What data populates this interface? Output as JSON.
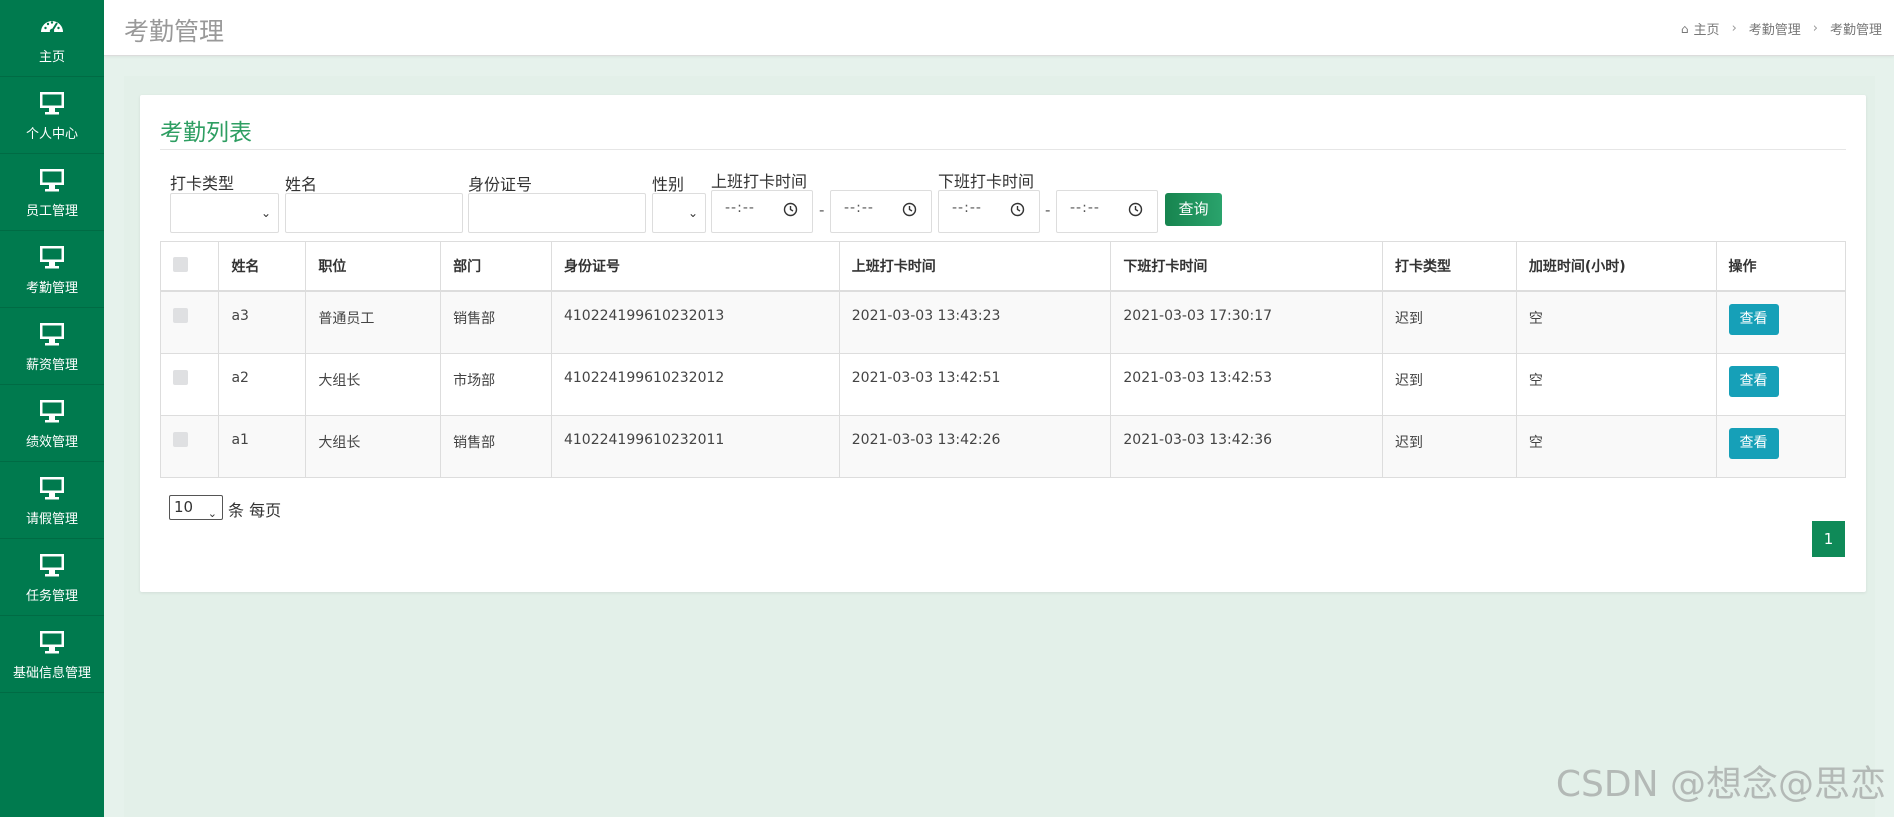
{
  "sidebar": {
    "items": [
      {
        "label": "主页",
        "icon": "dashboard-icon"
      },
      {
        "label": "个人中心",
        "icon": "monitor-icon"
      },
      {
        "label": "员工管理",
        "icon": "monitor-icon"
      },
      {
        "label": "考勤管理",
        "icon": "monitor-icon"
      },
      {
        "label": "薪资管理",
        "icon": "monitor-icon"
      },
      {
        "label": "绩效管理",
        "icon": "monitor-icon"
      },
      {
        "label": "请假管理",
        "icon": "monitor-icon"
      },
      {
        "label": "任务管理",
        "icon": "monitor-icon"
      },
      {
        "label": "基础信息管理",
        "icon": "monitor-icon"
      }
    ]
  },
  "header": {
    "title": "考勤管理",
    "breadcrumb": [
      "主页",
      "考勤管理",
      "考勤管理"
    ]
  },
  "card": {
    "title": "考勤列表"
  },
  "filters": {
    "punch_type_label": "打卡类型",
    "name_label": "姓名",
    "id_label": "身份证号",
    "gender_label": "性别",
    "clock_in_label": "上班打卡时间",
    "clock_out_label": "下班打卡时间",
    "time_placeholder": "--:--",
    "range_sep": "-",
    "query_label": "查询"
  },
  "table": {
    "headers": [
      "姓名",
      "职位",
      "部门",
      "身份证号",
      "上班打卡时间",
      "下班打卡时间",
      "打卡类型",
      "加班时间(小时)",
      "操作"
    ],
    "rows": [
      {
        "name": "a3",
        "position": "普通员工",
        "dept": "销售部",
        "id": "410224199610232013",
        "in": "2021-03-03 13:43:23",
        "out": "2021-03-03 17:30:17",
        "type": "迟到",
        "overtime": "空",
        "action": "查看"
      },
      {
        "name": "a2",
        "position": "大组长",
        "dept": "市场部",
        "id": "410224199610232012",
        "in": "2021-03-03 13:42:51",
        "out": "2021-03-03 13:42:53",
        "type": "迟到",
        "overtime": "空",
        "action": "查看"
      },
      {
        "name": "a1",
        "position": "大组长",
        "dept": "销售部",
        "id": "410224199610232011",
        "in": "2021-03-03 13:42:26",
        "out": "2021-03-03 13:42:36",
        "type": "迟到",
        "overtime": "空",
        "action": "查看"
      }
    ]
  },
  "pagination": {
    "page_size": "10",
    "page_size_suffix": "条 每页",
    "current_page": "1"
  },
  "watermark": "CSDN @想念@思恋",
  "colors": {
    "sidebar": "#007a4e",
    "accent": "#2e9e62",
    "view_button": "#16a0b8"
  }
}
